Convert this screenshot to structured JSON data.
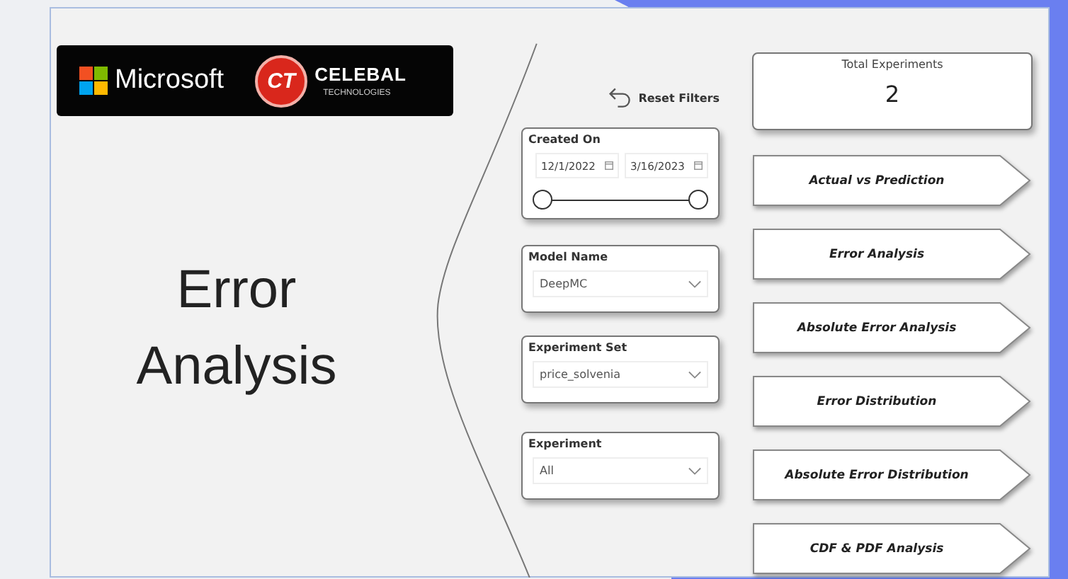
{
  "logo_banner": {
    "microsoft": "Microsoft",
    "ct_mark": "CT",
    "celebal": "CELEBAL",
    "celebal_sub": "TECHNOLOGIES"
  },
  "title": [
    "Error",
    "Analysis"
  ],
  "reset_filters": "Reset Filters",
  "date_filter": {
    "label": "Created On",
    "start": "12/1/2022",
    "end": "3/16/2023",
    "range": {
      "low": {
        "level": 0
      },
      "high": {
        "level": 1
      }
    }
  },
  "dropdowns": [
    {
      "label": "Model Name",
      "value": "DeepMC"
    },
    {
      "label": "Experiment Set",
      "value": "price_solvenia"
    },
    {
      "label": "Experiment",
      "value": "All"
    }
  ],
  "total_card": {
    "label": "Total Experiments",
    "value": "2"
  },
  "nav_buttons": [
    "Actual vs Prediction",
    "Error Analysis",
    "Absolute Error Analysis",
    "Error Distribution",
    "Absolute Error Distribution",
    "CDF & PDF Analysis"
  ]
}
